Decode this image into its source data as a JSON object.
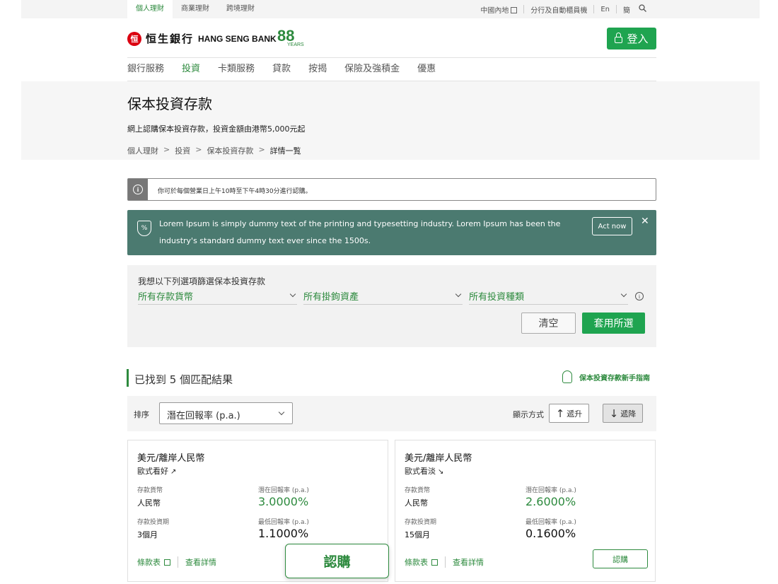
{
  "utility": {
    "tabs": [
      "個人理財",
      "商業理財",
      "跨境理財"
    ],
    "links": [
      "中國內地",
      "分行及自動櫃員機",
      "En",
      "簡"
    ]
  },
  "brand": {
    "mark": "恒",
    "name_cn": "恒生銀行",
    "name_en": "HANG SENG BANK",
    "anniv_num": "88",
    "anniv_word": "YEARS"
  },
  "login": {
    "label": "登入"
  },
  "nav": [
    "銀行服務",
    "投資",
    "卡類服務",
    "貸款",
    "按揭",
    "保險及強積金",
    "優惠"
  ],
  "page": {
    "title": "保本投資存款",
    "subtitle": "網上認購保本投資存款，投資金額由港幣5,000元起",
    "breadcrumb": [
      "個人理財",
      "投資",
      "保本投資存款",
      "詳情一覧"
    ]
  },
  "notice": {
    "text": "你可於每個營業日上午10時至下午4時30分進行認購。"
  },
  "promo": {
    "text": "Lorem Ipsum is simply dummy text of the printing and typesetting industry. Lorem Ipsum has been the industry's standard dummy text ever since the 1500s.",
    "button": "Act now"
  },
  "filter": {
    "label": "我想以下列選項篩選保本投資存款",
    "selects": [
      "所有存款貨幣",
      "所有掛鉤資產",
      "所有投資種類"
    ],
    "clear": "清空",
    "apply": "套用所選"
  },
  "results": {
    "title": "已找到 5 個匹配結果",
    "guide": "保本投資存款新手指南"
  },
  "sort": {
    "label": "排序",
    "value": "潛在回報率 (p.a.)",
    "display_label": "顯示方式",
    "asc": "遞升",
    "desc": "遞降"
  },
  "cards": [
    {
      "title": "美元/離岸人民幣",
      "style": "歐式看好",
      "trend": "↗",
      "currency_label": "存款貨幣",
      "currency": "人民幣",
      "tenor_label": "存款投資期",
      "tenor": "3個月",
      "potential_label": "潛在回報率 (p.a.)",
      "potential": "3.0000%",
      "min_label": "最低回報率 (p.a.)",
      "min": "1.1000%",
      "terms": "條款表",
      "details": "查看詳情"
    },
    {
      "title": "美元/離岸人民幣",
      "style": "歐式看淡",
      "trend": "↘",
      "currency_label": "存款貨幣",
      "currency": "人民幣",
      "tenor_label": "存款投資期",
      "tenor": "15個月",
      "potential_label": "潛在回報率 (p.a.)",
      "potential": "2.6000%",
      "min_label": "最低回報率 (p.a.)",
      "min": "0.1600%",
      "terms": "條款表",
      "details": "查看詳情",
      "subscribe": "認購"
    }
  ],
  "subscribe_main": "認購",
  "colors": {
    "brand_green": "#2d8a3e",
    "button_green": "#1fa450",
    "promo_bg": "#4b7a70",
    "brand_red": "#db0011"
  }
}
